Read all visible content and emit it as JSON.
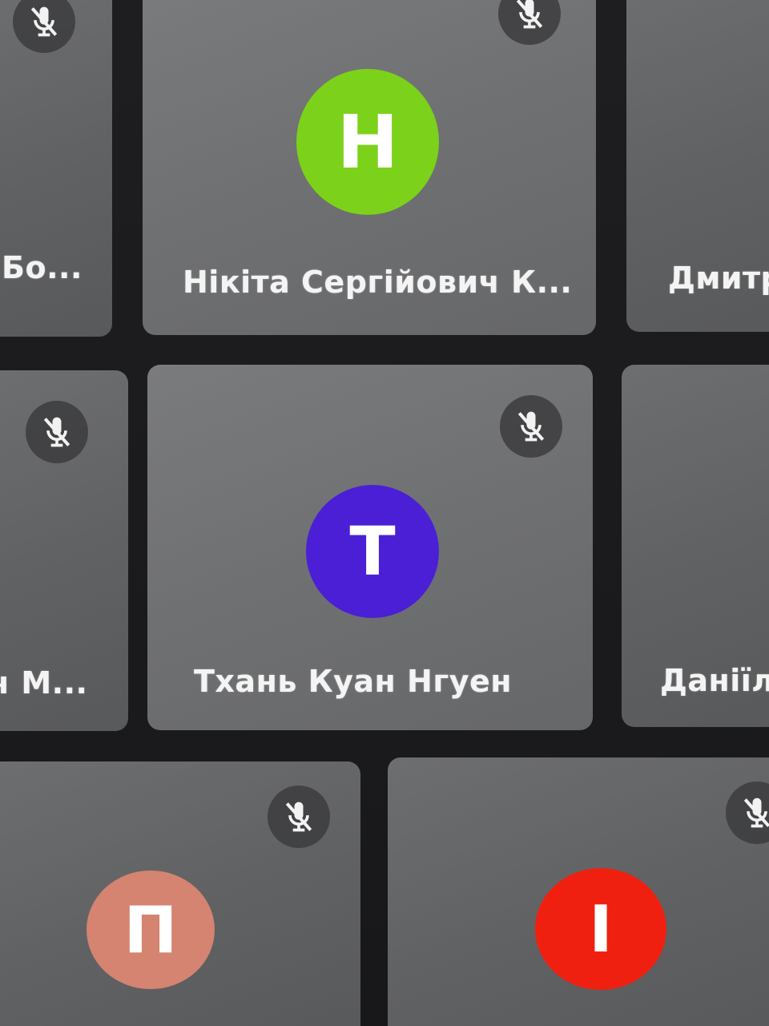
{
  "colors": {
    "background": "#1c1c1e",
    "tile": "#6a6b6d",
    "mic_bg": "#3c3c3e",
    "avatar_green": "#7cd21a",
    "avatar_purple": "#4a1fd6",
    "avatar_salmon": "#d48470",
    "avatar_red": "#f02010"
  },
  "participants": [
    {
      "name": "Бо...",
      "initial": "",
      "muted": true
    },
    {
      "name": "Нікіта Сергійович К...",
      "initial": "Н",
      "muted": true,
      "avatar_color": "#7cd21a"
    },
    {
      "name": "Дмитр",
      "initial": "",
      "muted": false
    },
    {
      "name": "ч М...",
      "initial": "",
      "muted": true
    },
    {
      "name": "Тхань Куан Нгуен",
      "initial": "Т",
      "muted": true,
      "avatar_color": "#4a1fd6"
    },
    {
      "name": "Даніїл",
      "initial": "",
      "muted": false
    },
    {
      "name": "",
      "initial": "П",
      "muted": true,
      "avatar_color": "#d48470"
    },
    {
      "name": "",
      "initial": "І",
      "muted": true,
      "avatar_color": "#f02010"
    }
  ],
  "icons": {
    "mute": "microphone-off-icon"
  }
}
